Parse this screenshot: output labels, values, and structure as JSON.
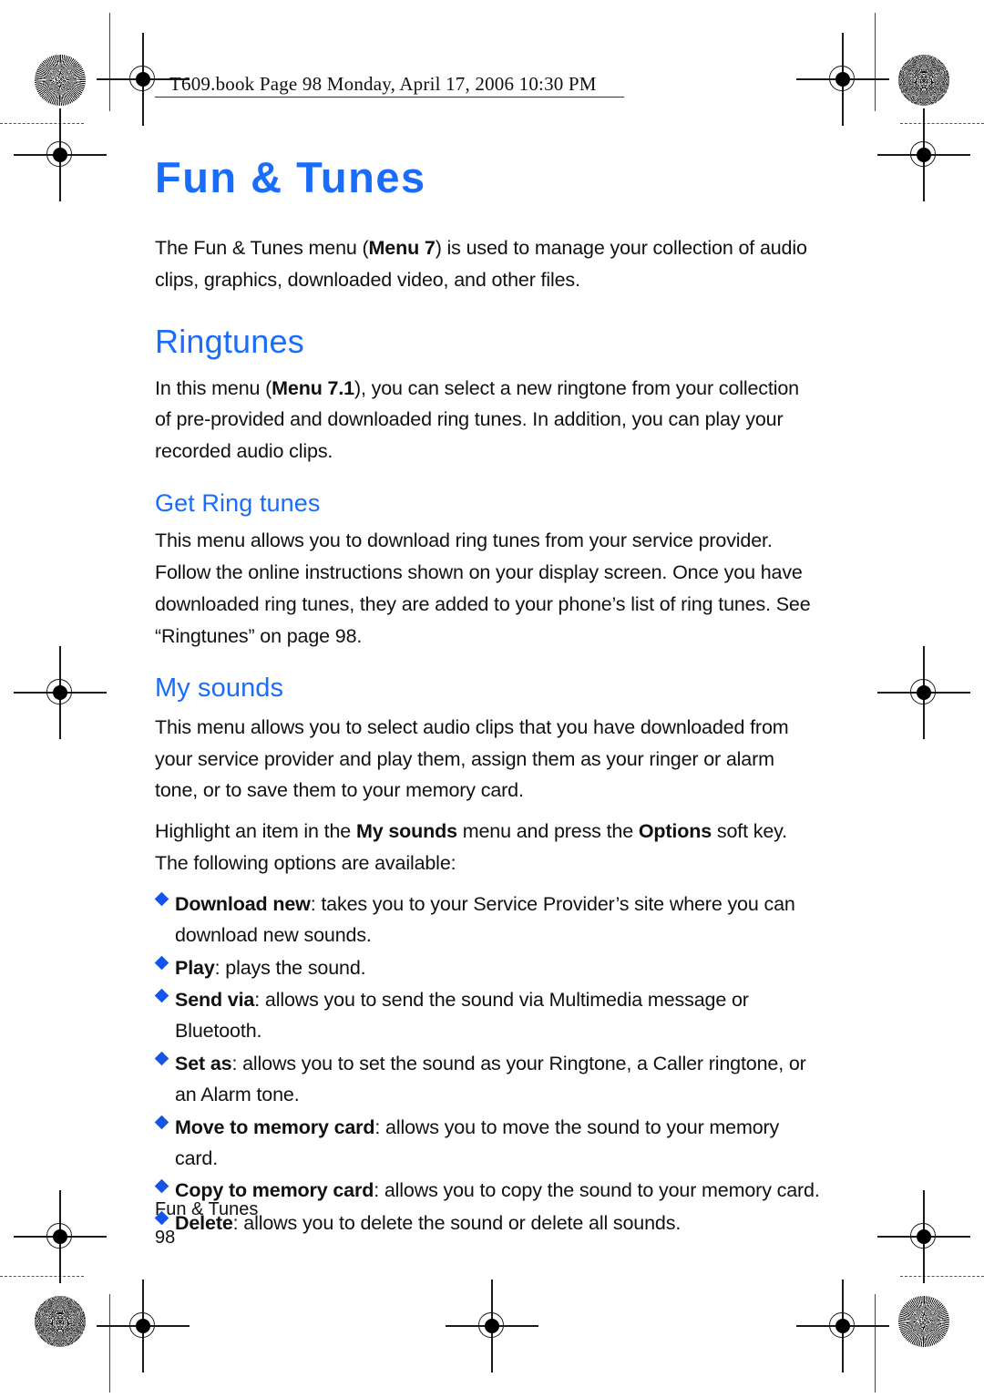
{
  "header": {
    "book_line": "T609.book  Page 98  Monday, April 17, 2006  10:30 PM"
  },
  "title": "Fun & Tunes",
  "intro": {
    "text_1": "The Fun & Tunes menu (",
    "bold_1": "Menu 7",
    "text_2": ") is used to manage your collection of audio clips, graphics, downloaded video, and other files."
  },
  "ringtunes": {
    "heading": "Ringtunes",
    "para": {
      "text_1": "In this menu (",
      "bold_1": "Menu 7.1",
      "text_2": "), you can select a new ringtone from your collection of pre-provided and downloaded ring tunes. In addition, you can play your recorded audio clips."
    },
    "get_ring_tunes": {
      "heading": "Get Ring tunes",
      "para": "This menu allows you to download ring tunes from your service provider. Follow the online instructions shown on your display screen. Once you have downloaded ring tunes, they are added to your phone’s list of ring tunes. See “Ringtunes” on page 98."
    }
  },
  "my_sounds": {
    "heading": "My sounds",
    "para_1": "This menu allows you to select audio clips that you have downloaded from your service provider and play them, assign them as your ringer or alarm tone, or to save them to your memory card.",
    "para_2": {
      "text_1": "Highlight an item in the ",
      "bold_1": "My sounds",
      "text_2": " menu and press the ",
      "bold_2": "Options",
      "text_3": " soft key. The following options are available:"
    },
    "options": [
      {
        "label": "Download new",
        "desc": ": takes you to your Service Provider’s site where you can download new sounds."
      },
      {
        "label": "Play",
        "desc": ": plays the sound."
      },
      {
        "label": "Send via",
        "desc": ": allows you to send the sound via Multimedia message or Bluetooth."
      },
      {
        "label": "Set as",
        "desc": ": allows you to set the sound as your Ringtone, a Caller ringtone, or an Alarm tone."
      },
      {
        "label": "Move to memory card",
        "desc": ": allows you to move the sound to your memory card."
      },
      {
        "label": "Copy to memory card",
        "desc": ": allows you to copy the sound to your memory card."
      },
      {
        "label": "Delete",
        "desc": ": allows you to delete the sound or delete all sounds."
      }
    ]
  },
  "footer": {
    "chapter": "Fun & Tunes",
    "page_number": "98"
  },
  "colors": {
    "heading_blue": "#1a6dfa",
    "bullet_blue": "#1454e8",
    "text_black": "#111111"
  }
}
